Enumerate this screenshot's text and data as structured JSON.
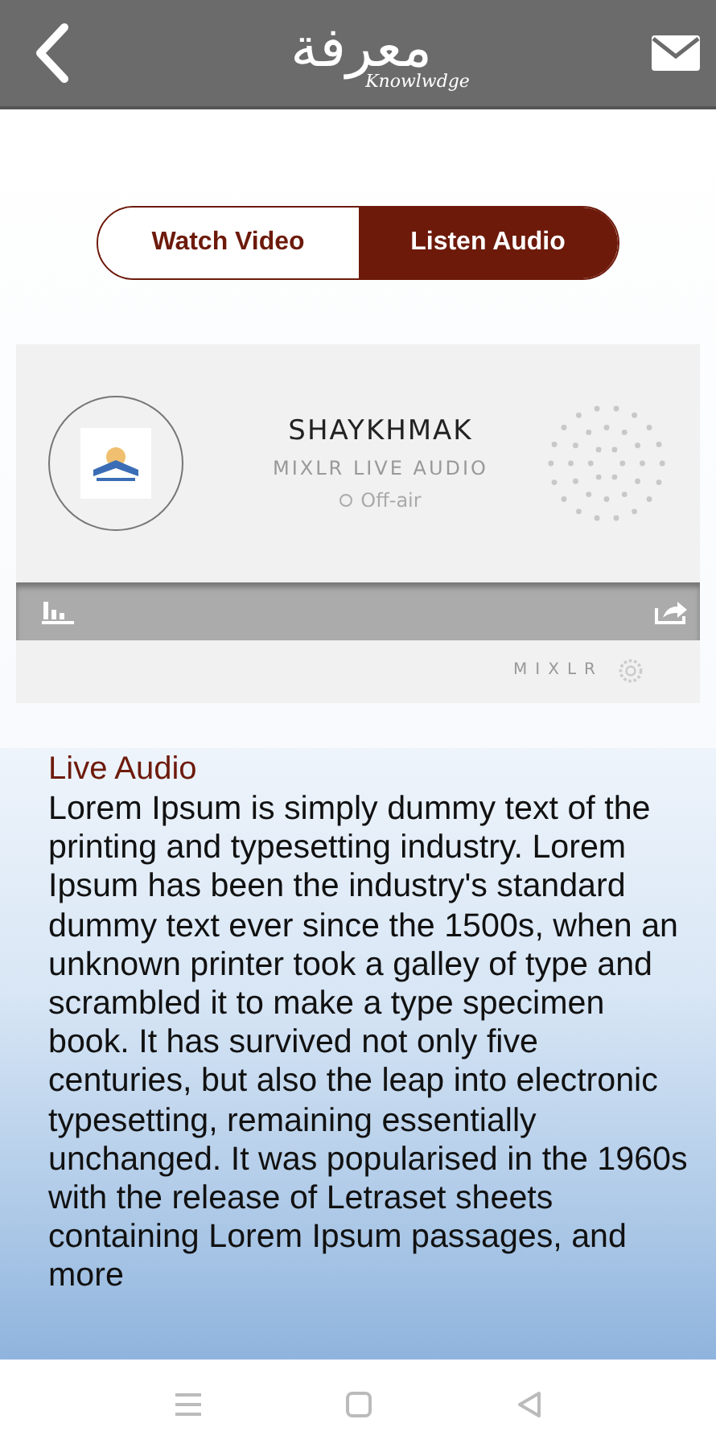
{
  "header": {
    "title": "معرفة",
    "subtitle": "Knowlwdge"
  },
  "tabs": [
    {
      "label": "Watch Video",
      "selected": false
    },
    {
      "label": "Listen Audio",
      "selected": true
    }
  ],
  "player": {
    "name": "SHAYKHMAK",
    "service": "MIXLR LIVE AUDIO",
    "status": "Off-air",
    "on_air": false,
    "brand": "MIXLR"
  },
  "article": {
    "heading": "Live Audio",
    "body": "Lorem Ipsum is simply dummy text of the printing and typesetting industry. Lorem Ipsum has been the industry's standard dummy text ever since the 1500s, when an unknown printer took a galley of type and scrambled it to make a type specimen book. It has survived not only five centuries, but also the leap into electronic typesetting, remaining essentially unchanged. It was popularised in the 1960s with the release of Letraset sheets containing Lorem Ipsum passages, and more"
  }
}
